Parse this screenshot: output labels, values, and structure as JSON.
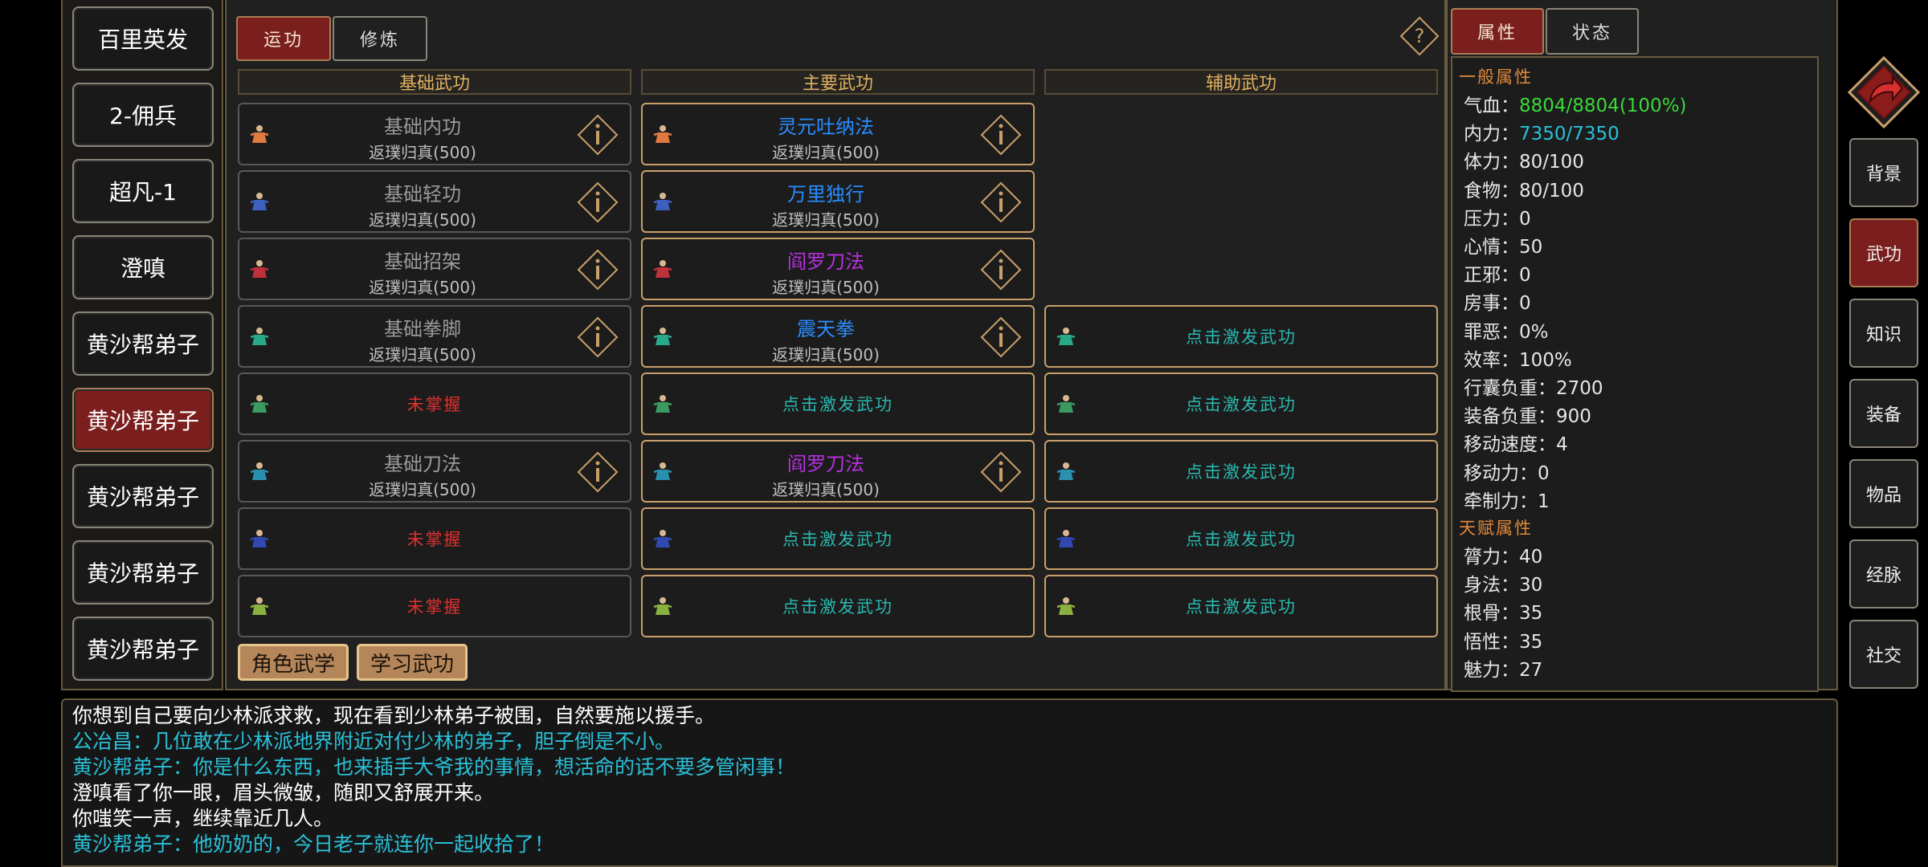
{
  "characters": [
    "百里英发",
    "2-佣兵",
    "超凡-1",
    "澄嗔",
    "黄沙帮弟子",
    "黄沙帮弟子",
    "黄沙帮弟子",
    "黄沙帮弟子",
    "黄沙帮弟子"
  ],
  "active_character_index": 5,
  "tabs": [
    {
      "label": "运功",
      "active": true
    },
    {
      "label": "修炼",
      "active": false
    }
  ],
  "help_icon": "?",
  "columns": {
    "basic": "基础武功",
    "main": "主要武功",
    "aux": "辅助武功"
  },
  "rows": [
    {
      "icon": "meditation-icon",
      "icon_color": "#e07a40",
      "basic": {
        "kind": "skill",
        "name": "基础内功",
        "sub": "返璞归真(500)"
      },
      "main": {
        "kind": "skill",
        "name": "灵元吐纳法",
        "sub": "返璞归真(500)",
        "color": "#2a8cff"
      },
      "aux": {
        "kind": "none"
      }
    },
    {
      "icon": "lightness-icon",
      "icon_color": "#3d5fbf",
      "basic": {
        "kind": "skill",
        "name": "基础轻功",
        "sub": "返璞归真(500)"
      },
      "main": {
        "kind": "skill",
        "name": "万里独行",
        "sub": "返璞归真(500)",
        "color": "#2a8cff"
      },
      "aux": {
        "kind": "none"
      }
    },
    {
      "icon": "parry-icon",
      "icon_color": "#c0303a",
      "basic": {
        "kind": "skill",
        "name": "基础招架",
        "sub": "返璞归真(500)"
      },
      "main": {
        "kind": "skill",
        "name": "阎罗刀法",
        "sub": "返璞归真(500)",
        "color": "#b830e0"
      },
      "aux": {
        "kind": "none"
      }
    },
    {
      "icon": "fist-icon",
      "icon_color": "#2aa88a",
      "basic": {
        "kind": "skill",
        "name": "基础拳脚",
        "sub": "返璞归真(500)"
      },
      "main": {
        "kind": "skill",
        "name": "震天拳",
        "sub": "返璞归真(500)",
        "color": "#2a8cff"
      },
      "aux": {
        "kind": "activate",
        "text": "点击激发武功"
      }
    },
    {
      "icon": "sword-icon",
      "icon_color": "#3a9a60",
      "basic": {
        "kind": "unlearned",
        "text": "未掌握"
      },
      "main": {
        "kind": "activate",
        "text": "点击激发武功"
      },
      "aux": {
        "kind": "activate",
        "text": "点击激发武功"
      }
    },
    {
      "icon": "blade-icon",
      "icon_color": "#2a90b0",
      "basic": {
        "kind": "skill",
        "name": "基础刀法",
        "sub": "返璞归真(500)"
      },
      "main": {
        "kind": "skill",
        "name": "阎罗刀法",
        "sub": "返璞归真(500)",
        "color": "#b830e0"
      },
      "aux": {
        "kind": "activate",
        "text": "点击激发武功"
      }
    },
    {
      "icon": "staff-icon",
      "icon_color": "#3048b0",
      "basic": {
        "kind": "unlearned",
        "text": "未掌握"
      },
      "main": {
        "kind": "activate",
        "text": "点击激发武功"
      },
      "aux": {
        "kind": "activate",
        "text": "点击激发武功"
      }
    },
    {
      "icon": "whip-icon",
      "icon_color": "#8ab040",
      "basic": {
        "kind": "unlearned",
        "text": "未掌握"
      },
      "main": {
        "kind": "activate",
        "text": "点击激发武功"
      },
      "aux": {
        "kind": "activate",
        "text": "点击激发武功"
      }
    }
  ],
  "buttons": {
    "char_martial": "角色武学",
    "learn_martial": "学习武功"
  },
  "attr_tabs": [
    {
      "label": "属性",
      "active": true
    },
    {
      "label": "状态",
      "active": false
    }
  ],
  "general_title": "一般属性",
  "general": [
    {
      "label": "气血：",
      "value": "8804/8804(100%)",
      "color": "#3ad83a"
    },
    {
      "label": "内力：",
      "value": "7350/7350",
      "color": "#2ac0d8"
    },
    {
      "label": "体力：",
      "value": "80/100"
    },
    {
      "label": "食物：",
      "value": "80/100"
    },
    {
      "label": "压力：",
      "value": "0"
    },
    {
      "label": "心情：",
      "value": "50"
    },
    {
      "label": "正邪：",
      "value": "0"
    },
    {
      "label": "房事：",
      "value": "0"
    },
    {
      "label": "罪恶：",
      "value": "0%"
    },
    {
      "label": "效率：",
      "value": "100%"
    },
    {
      "label": "行囊负重：",
      "value": "2700"
    },
    {
      "label": "装备负重：",
      "value": "900"
    },
    {
      "label": "移动速度：",
      "value": "4"
    },
    {
      "label": "移动力：",
      "value": "0"
    },
    {
      "label": "牵制力：",
      "value": "1"
    }
  ],
  "talent_title": "天赋属性",
  "talent": [
    {
      "label": "膂力：",
      "value": "40"
    },
    {
      "label": "身法：",
      "value": "30"
    },
    {
      "label": "根骨：",
      "value": "35"
    },
    {
      "label": "悟性：",
      "value": "35"
    },
    {
      "label": "魅力：",
      "value": "27"
    }
  ],
  "nav": [
    {
      "label": "背景",
      "active": false
    },
    {
      "label": "武功",
      "active": true
    },
    {
      "label": "知识",
      "active": false
    },
    {
      "label": "装备",
      "active": false
    },
    {
      "label": "物品",
      "active": false
    },
    {
      "label": "经脉",
      "active": false
    },
    {
      "label": "社交",
      "active": false
    }
  ],
  "log": [
    {
      "text": "你想到自己要向少林派求救，现在看到少林弟子被围，自然要施以援手。",
      "color": "#ffffff"
    },
    {
      "text": "公冶昌：几位敢在少林派地界附近对付少林的弟子，胆子倒是不小。",
      "color": "#2ac0d8"
    },
    {
      "text": "黄沙帮弟子：你是什么东西，也来插手大爷我的事情，想活命的话不要多管闲事！",
      "color": "#2ac0d8"
    },
    {
      "text": "澄嗔看了你一眼，眉头微皱，随即又舒展开来。",
      "color": "#ffffff"
    },
    {
      "text": "你嗤笑一声，继续靠近几人。",
      "color": "#ffffff"
    },
    {
      "text": "黄沙帮弟子：他奶奶的，今日老子就连你一起收拾了！",
      "color": "#2ac0d8"
    }
  ],
  "colors": {
    "unlearned": "#e03030",
    "activate": "#2ab8b0",
    "grey_text": "#9a9a9a",
    "accent_red": "#7b1e1e",
    "gold_border": "#c9a06a"
  }
}
